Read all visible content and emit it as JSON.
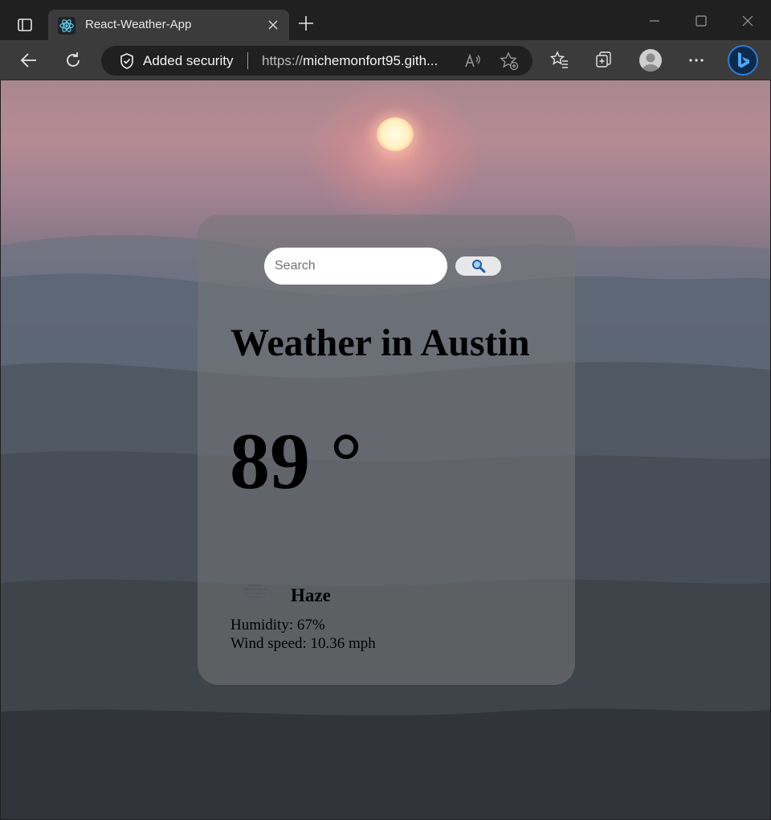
{
  "browser": {
    "tab": {
      "title": "React-Weather-App",
      "favicon": "react-logo-icon"
    },
    "address_bar": {
      "security_label": "Added security",
      "url_prefix": "https://",
      "url_host": "michemonfort95.gith...",
      "security_icon": "shield-icon"
    },
    "toolbar_icons": [
      "back-arrow-icon",
      "refresh-icon",
      "read-aloud-icon",
      "add-favorite-icon",
      "favorites-icon",
      "collections-icon",
      "profile-avatar",
      "more-icon",
      "bing-copilot-icon"
    ],
    "accent_color": "#2c7ed6"
  },
  "app": {
    "search": {
      "placeholder": "Search",
      "value": "",
      "button_icon": "magnifier-icon"
    },
    "city_heading": "Weather in Austin",
    "temperature": "89 °",
    "condition": {
      "label": "Haze",
      "icon": "haze-icon"
    },
    "humidity": "Humidity: 67%",
    "wind": "Wind speed: 10.36 mph",
    "background": "sunset-over-hazy-countryside-photo"
  }
}
